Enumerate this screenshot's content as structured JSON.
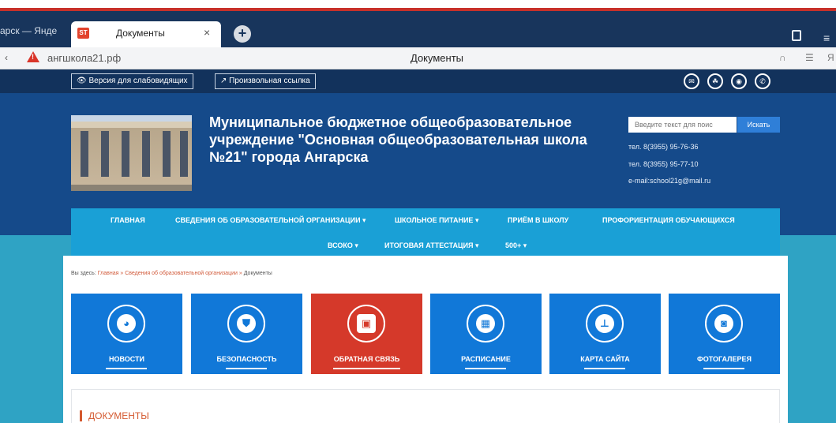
{
  "browser": {
    "prev_tab_title": "арск — Янде",
    "active_tab": {
      "favicon_text": "ST",
      "title": "Документы",
      "close": "×"
    },
    "new_tab": "+",
    "menu_glyph": "≡",
    "back_glyph": "‹",
    "warning_glyph": "!",
    "url": "ангшкола21.рф",
    "page_title": "Документы",
    "right_icons": [
      "∩",
      "☰",
      "Я"
    ]
  },
  "utility_bar": {
    "low_vision_label": "👁 Версия для слабовидящих",
    "custom_link_label": "↗ Произвольная ссылка",
    "social_icons": [
      "mail-icon",
      "group-icon",
      "rss-icon",
      "phone-icon"
    ],
    "social_glyphs": [
      "✉",
      "☘",
      "◉",
      "✆"
    ]
  },
  "header": {
    "org_title": "Муниципальное бюджетное общеобразовательное учреждение \"Основная общеобразовательная школа №21\" города Ангарска",
    "search_placeholder": "Введите текст для поис",
    "search_button": "Искать",
    "phone1": "тел. 8(3955) 95-76-36",
    "phone2": "тел. 8(3955) 95-77-10",
    "email": "e-mail:school21g@mail.ru"
  },
  "nav": {
    "items": [
      "ГЛАВНАЯ",
      "СВЕДЕНИЯ ОБ ОБРАЗОВАТЕЛЬНОЙ ОРГАНИЗАЦИИ ▾",
      "ШКОЛЬНОЕ ПИТАНИЕ ▾",
      "ПРИЁМ В ШКОЛУ",
      "ПРОФОРИЕНТАЦИЯ ОБУЧАЮЩИХСЯ",
      "ВСОКО ▾",
      "ИТОГОВАЯ АТТЕСТАЦИЯ ▾",
      "500+ ▾"
    ]
  },
  "breadcrumb": {
    "prefix": "Вы здесь:",
    "home": "Главная",
    "sep": "»",
    "section": "Сведения об образовательной организации",
    "current": "Документы"
  },
  "cards": [
    {
      "label": "НОВОСТИ",
      "icon": "globe-icon",
      "glyph": "◕",
      "active": false
    },
    {
      "label": "БЕЗОПАСНОСТЬ",
      "icon": "shield-icon",
      "glyph": "⛊",
      "active": false
    },
    {
      "label": "ОБРАТНАЯ СВЯЗЬ",
      "icon": "contact-book-icon",
      "glyph": "▣",
      "active": true
    },
    {
      "label": "РАСПИСАНИЕ",
      "icon": "calendar-icon",
      "glyph": "▦",
      "active": false
    },
    {
      "label": "КАРТА САЙТА",
      "icon": "sitemap-icon",
      "glyph": "⊥",
      "active": false
    },
    {
      "label": "ФОТОГАЛЕРЕЯ",
      "icon": "photo-icon",
      "glyph": "◙",
      "active": false
    }
  ],
  "documents_heading": "ДОКУМЕНТЫ",
  "colors": {
    "header_blue": "#154a8a",
    "nav_blue": "#1aa0d6",
    "card_blue": "#1178d8",
    "card_active_red": "#d5392a",
    "accent_orange": "#d4592f"
  }
}
